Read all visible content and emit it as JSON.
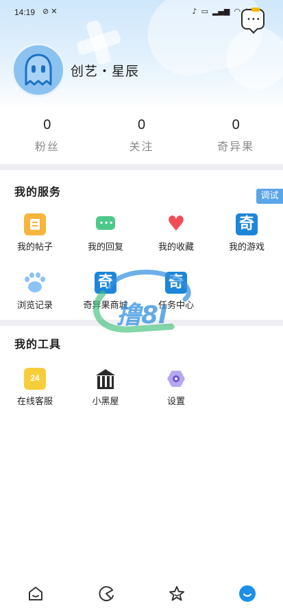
{
  "status_bar": {
    "time": "14:19",
    "left_icons": [
      "camera-off-icon",
      "tools-icon"
    ],
    "right_icons": [
      "mute-icon",
      "hd-icon",
      "signal-icon",
      "wifi-icon"
    ],
    "battery": "69"
  },
  "profile": {
    "username": "创艺・星辰",
    "avatar_icon": "ghost-icon"
  },
  "stats": [
    {
      "value": "0",
      "label": "粉丝"
    },
    {
      "value": "0",
      "label": "关注"
    },
    {
      "value": "0",
      "label": "奇异果"
    }
  ],
  "debug_tag": "调试",
  "services": {
    "title": "我的服务",
    "items": [
      {
        "label": "我的帖子",
        "icon": "post-icon"
      },
      {
        "label": "我的回复",
        "icon": "reply-icon"
      },
      {
        "label": "我的收藏",
        "icon": "heart-icon"
      },
      {
        "label": "我的游戏",
        "icon": "qi-icon",
        "glyph": "奇"
      },
      {
        "label": "浏览记录",
        "icon": "paw-icon"
      },
      {
        "label": "奇异果商城",
        "icon": "qi-icon",
        "glyph": "奇"
      },
      {
        "label": "任务中心",
        "icon": "qi-icon",
        "glyph": "奇"
      }
    ]
  },
  "tools": {
    "title": "我的工具",
    "items": [
      {
        "label": "在线客服",
        "icon": "support-24-icon",
        "glyph": "24"
      },
      {
        "label": "小黑屋",
        "icon": "jail-icon"
      },
      {
        "label": "设置",
        "icon": "settings-icon"
      }
    ]
  },
  "watermark": {
    "text": "撸8I"
  },
  "bottom_nav": [
    {
      "icon": "home-icon",
      "active": false
    },
    {
      "icon": "explore-icon",
      "active": false
    },
    {
      "icon": "star-icon",
      "active": false
    },
    {
      "icon": "profile-icon",
      "active": true
    }
  ],
  "colors": {
    "accent": "#1d86d8",
    "active_tab": "#1d8fe8"
  }
}
